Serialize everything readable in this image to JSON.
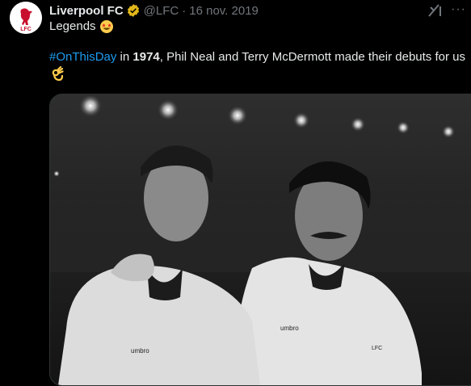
{
  "tweet": {
    "author_name": "Liverpool FC",
    "handle": "@LFC",
    "separator": "·",
    "date": "16 nov. 2019",
    "line1": "Legends",
    "hashtag": "#OnThisDay",
    "text_in": " in ",
    "year": "1974",
    "text_rest": ", Phil Neal and Terry McDermott made their debuts for us",
    "avatar_text": "LFC",
    "more_label": "···"
  },
  "photo": {
    "shirt_left": "umbro",
    "shirt_right": "umbro",
    "crest_text": "LFC"
  },
  "colors": {
    "background": "#000000",
    "text": "#e7e9ea",
    "secondary": "#71767b",
    "link": "#1d9bf0",
    "verified": "#e2b719",
    "brand_red": "#c8102e"
  }
}
